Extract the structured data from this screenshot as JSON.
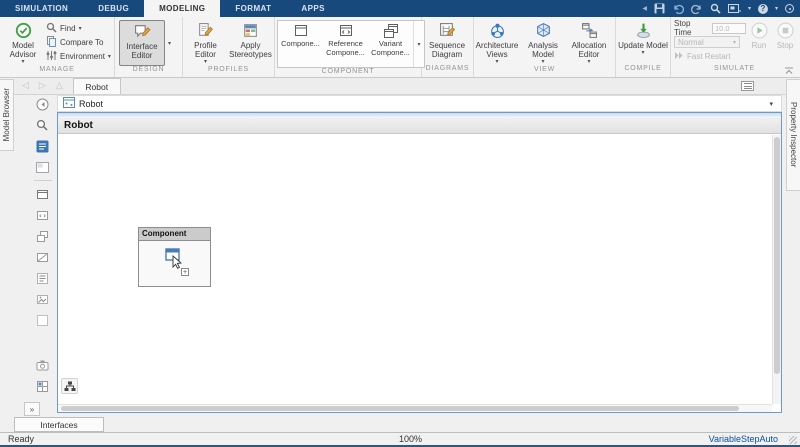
{
  "glyphs": {
    "caret": "▾",
    "chevron_left": "◀",
    "overflow": "»",
    "back": "◁",
    "forward": "▷",
    "up": "△",
    "help": "?",
    "plus": "+"
  },
  "menu_tabs": {
    "active": "MODELING",
    "items": [
      {
        "label": "SIMULATION"
      },
      {
        "label": "DEBUG"
      },
      {
        "label": "MODELING"
      },
      {
        "label": "FORMAT"
      },
      {
        "label": "APPS"
      }
    ]
  },
  "quick_access": {
    "icons": [
      "save-icon",
      "undo-icon",
      "redo-icon",
      "search-icon",
      "screenshot-icon",
      "help-icon",
      "status-circle-icon"
    ]
  },
  "ribbon": {
    "manage": {
      "label": "MANAGE",
      "model_advisor": "Model Advisor",
      "find": "Find",
      "compare_to": "Compare To",
      "environment": "Environment"
    },
    "design": {
      "label": "DESIGN",
      "interface_editor": "Interface Editor",
      "interface_editor_selected": true
    },
    "profiles": {
      "label": "PROFILES",
      "profile_editor": "Profile Editor",
      "apply_stereotypes": "Apply Stereotypes"
    },
    "component": {
      "label": "COMPONENT",
      "component": "Compone...",
      "reference_component": "Reference Compone...",
      "variant_component": "Variant Compone..."
    },
    "diagrams": {
      "label": "DIAGRAMS",
      "sequence_diagram": "Sequence Diagram"
    },
    "view": {
      "label": "VIEW",
      "architecture_views": "Architecture Views",
      "analysis_model": "Analysis Model",
      "allocation_editor": "Allocation Editor"
    },
    "compile": {
      "label": "COMPILE",
      "update_model": "Update Model"
    },
    "simulate": {
      "label": "SIMULATE",
      "stop_time_label": "Stop Time",
      "stop_time_value": "10.0",
      "mode": "Normal",
      "fast_restart": "Fast Restart",
      "run": "Run",
      "stop": "Stop",
      "controls_disabled": true
    }
  },
  "editor": {
    "document_tab": "Robot",
    "breadcrumb": "Robot",
    "canvas_title": "Robot"
  },
  "component_block": {
    "title": "Component"
  },
  "panels": {
    "left_tab": "Model Browser",
    "right_tab": "Property Inspector",
    "bottom_tab": "Interfaces"
  },
  "status_bar": {
    "state": "Ready",
    "zoom": "100%",
    "solver": "VariableStepAuto"
  },
  "palette": {
    "icons": [
      "hide-panel-icon",
      "zoom-icon",
      "library-browser-icon",
      "minimap-icon",
      "component-icon",
      "reference-component-icon",
      "variant-component-icon",
      "adapter-icon",
      "annotation-icon",
      "image-icon",
      "area-icon",
      "viewmark-icon",
      "stereotype-icon"
    ]
  },
  "colors": {
    "titlebar": "#17497d",
    "canvas_frame": "#6d9ac6",
    "solver_link": "#0b4ea2",
    "selected_button_bg": "#dcdcdc",
    "run_green": "#9cc79c",
    "advisor_green": "#43a047",
    "pencil_orange": "#e8a33d",
    "library_blue": "#3b76b0"
  }
}
